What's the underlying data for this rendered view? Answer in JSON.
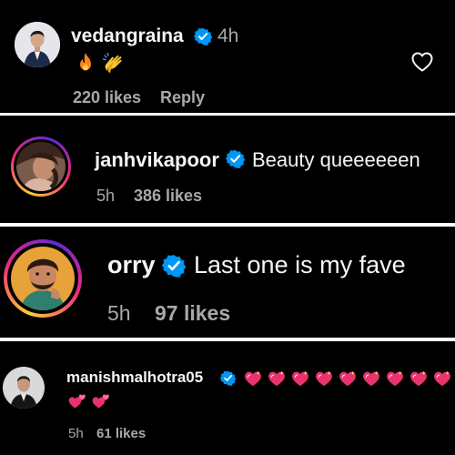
{
  "comments": [
    {
      "username": "vedangraina",
      "verified": true,
      "time": "4h",
      "text": "🔥 👏",
      "likes": "220 likes",
      "reply": "Reply",
      "icons": [
        "fire-emoji",
        "clapping-hands-emoji",
        "heart-outline-icon"
      ]
    },
    {
      "username": "janhvikapoor",
      "verified": true,
      "text": "Beauty queeeeeen",
      "time": "5h",
      "likes": "386 likes"
    },
    {
      "username": "orry",
      "verified": true,
      "text": "Last one is my fave",
      "time": "5h",
      "likes": "97 likes"
    },
    {
      "username": "manishmalhotra05",
      "verified": true,
      "text": "💖💖💖💖💖💖💖💖💖💕💕",
      "time": "5h",
      "likes": "61 likes",
      "icons": [
        "sparkling-heart-emoji",
        "two-hearts-emoji"
      ]
    }
  ],
  "colors": {
    "background": "#000000",
    "verified_blue": "#0095f6",
    "muted_text": "#a8a8a8",
    "story_ring": [
      "#f9ce34",
      "#ee2a7b",
      "#6228d7"
    ]
  }
}
